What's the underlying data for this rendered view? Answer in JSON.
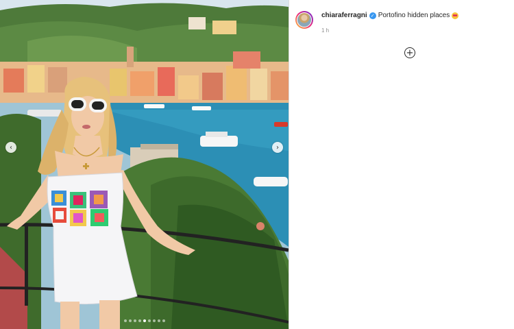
{
  "post": {
    "username": "chiaraferragni",
    "caption": "Portofino hidden places",
    "timestamp": "1 h"
  },
  "icons": {
    "verified": "verified-badge-icon",
    "prev": "chevron-left-icon",
    "next": "chevron-right-icon",
    "load_more": "plus-circle-icon",
    "emoji": "heart-eyes-emoji-icon"
  },
  "glyphs": {
    "prev": "‹",
    "next": "›",
    "plus": "+",
    "check": "✓"
  },
  "carousel": {
    "total": 9,
    "active_index": 4
  },
  "colors": {
    "verified": "#3897f0",
    "text": "#262626",
    "muted": "#8e8e8e",
    "divider": "#dbdbdb"
  }
}
